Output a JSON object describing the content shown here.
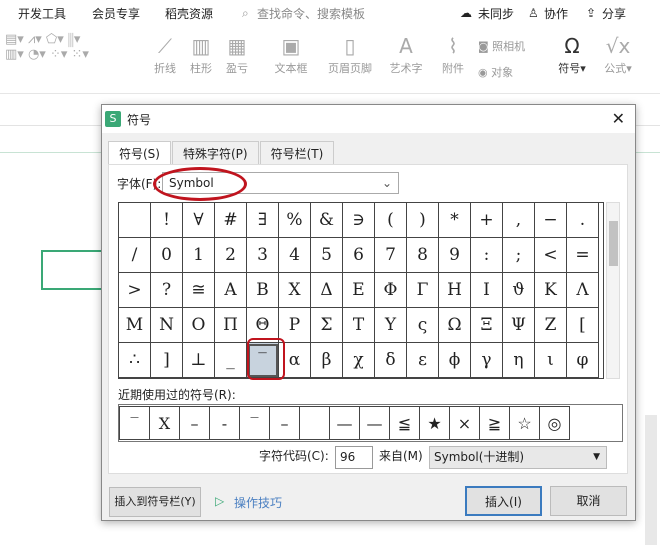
{
  "menu": {
    "items": [
      "开发工具",
      "会员专享",
      "稻壳资源"
    ],
    "search": "查找命令、搜索模板",
    "sync": "未同步",
    "collab": "协作",
    "share": "分享"
  },
  "ribbon": {
    "items": [
      "折线",
      "柱形",
      "盈亏",
      "文本框",
      "页眉页脚",
      "艺术字",
      "附件",
      "照相机",
      "对象",
      "符号",
      "公式"
    ]
  },
  "dialog": {
    "title": "符号",
    "logo": "S",
    "close": "✕",
    "tabs": [
      "符号(S)",
      "特殊字符(P)",
      "符号栏(T)"
    ],
    "font_label": "字体(F):",
    "font_value": "Symbol",
    "symbols": [
      " ",
      "!",
      "∀",
      "#",
      "∃",
      "%",
      "&",
      "∋",
      "(",
      ")",
      "*",
      "+",
      ",",
      "−",
      ".",
      "/",
      "0",
      "1",
      "2",
      "3",
      "4",
      "5",
      "6",
      "7",
      "8",
      "9",
      ":",
      ";",
      "<",
      "=",
      ">",
      "?",
      "≅",
      "Α",
      "Β",
      "Χ",
      "Δ",
      "Ε",
      "Φ",
      "Γ",
      "Η",
      "Ι",
      "ϑ",
      "Κ",
      "Λ",
      "Μ",
      "Ν",
      "Ο",
      "Π",
      "Θ",
      "Ρ",
      "Σ",
      "Τ",
      "Υ",
      "ς",
      "Ω",
      "Ξ",
      "Ψ",
      "Ζ",
      "[",
      "∴",
      "]",
      "⊥",
      "_",
      "‾",
      "α",
      "β",
      "χ",
      "δ",
      "ε",
      "ϕ",
      "γ",
      "η",
      "ι",
      "φ"
    ],
    "selected_index": 64,
    "recent_label": "近期使用过的符号(R):",
    "recent": [
      "‾",
      "X",
      "–",
      "-",
      "‾",
      "–",
      " ",
      "—",
      "—",
      "≦",
      "★",
      "×",
      "≧",
      "☆",
      "◎"
    ],
    "code_label": "字符代码(C):",
    "code_value": "96",
    "from_label": "来自(M)",
    "from_value": "Symbol(十进制)",
    "insert_bar": "插入到符号栏(Y)",
    "tips": "操作技巧",
    "insert": "插入(I)",
    "cancel": "取消"
  }
}
